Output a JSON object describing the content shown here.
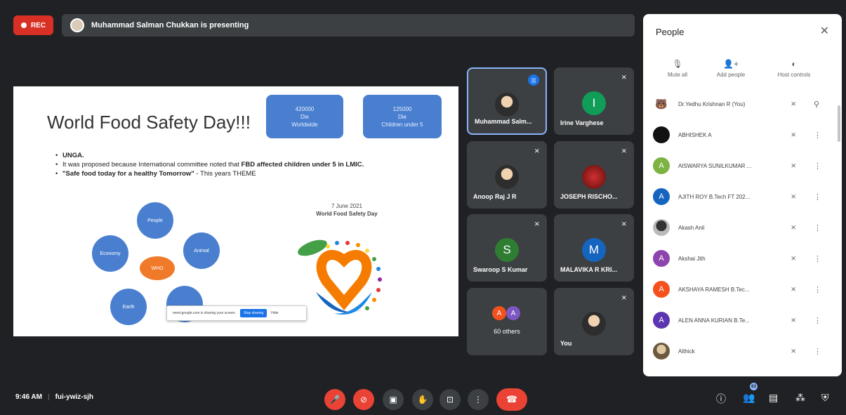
{
  "topbar": {
    "rec_label": "REC",
    "presenting_text": "Muhammad Salman Chukkan is presenting"
  },
  "slide": {
    "title": "World Food Safety Day!!!",
    "box1": {
      "line1": "420000",
      "line2": "Die",
      "line3": "Worldwide"
    },
    "box2": {
      "line1": "125000",
      "line2": "Die",
      "line3": "Children under 5"
    },
    "bullet1": "UNGA.",
    "bullet2_pre": "It was proposed because International committee noted that ",
    "bullet2_bold": "FBD affected children under 5 in LMIC.",
    "bullet3_bold": "\"Safe food today for a healthy Tomorrow\"",
    "bullet3_rest": " - This years THEME",
    "cycle_center": "WHO",
    "cycle_nodes": [
      "People",
      "Animal",
      "Economy",
      "Earth"
    ],
    "logo_date": "7 June 2021",
    "logo_title": "World Food Safety Day",
    "share_text": "meet.google.com is sharing your screen.",
    "share_stop": "Stop sharing",
    "share_hide": "Hide"
  },
  "tiles": [
    {
      "name": "Muhammad Salm...",
      "initial": "",
      "color": ""
    },
    {
      "name": "Irine Varghese",
      "initial": "I",
      "color": "#0f9d58"
    },
    {
      "name": "Anoop Raj J R",
      "initial": "",
      "color": ""
    },
    {
      "name": "JOSEPH RISCHO...",
      "initial": "",
      "color": "#b71c1c"
    },
    {
      "name": "Swaroop S Kumar",
      "initial": "S",
      "color": "#2e7d32"
    },
    {
      "name": "MALAVIKA R KRI...",
      "initial": "M",
      "color": "#1565c0"
    },
    {
      "name": "60 others",
      "initial": "",
      "color": ""
    },
    {
      "name": "You",
      "initial": "",
      "color": ""
    }
  ],
  "others_initials": [
    "A",
    "A"
  ],
  "people_panel": {
    "title": "People",
    "actions": [
      "Mute all",
      "Add people",
      "Host controls"
    ],
    "participants": [
      {
        "name": "Dr.Yedhu Krishnan R (You)",
        "initial": "",
        "color": "#8d6e63"
      },
      {
        "name": "ABHISHEK A",
        "initial": "",
        "color": "#111111"
      },
      {
        "name": "AISWARYA SUNILKUMAR ...",
        "initial": "A",
        "color": "#7cb342"
      },
      {
        "name": "AJITH ROY B.Tech FT 202...",
        "initial": "A",
        "color": "#1565c0"
      },
      {
        "name": "Akash Anil",
        "initial": "",
        "color": "#555555"
      },
      {
        "name": "Akshai Jith",
        "initial": "A",
        "color": "#8e44ad"
      },
      {
        "name": "AKSHAYA RAMESH B.Tec...",
        "initial": "A",
        "color": "#f4511e"
      },
      {
        "name": "ALEN ANNA KURIAN B.Te...",
        "initial": "A",
        "color": "#5e35b1"
      },
      {
        "name": "Althick",
        "initial": "",
        "color": "#8d7b5a"
      }
    ]
  },
  "bottombar": {
    "time": "9:46 AM",
    "meeting_code": "fui-ywiz-sjh",
    "people_count": "63"
  }
}
